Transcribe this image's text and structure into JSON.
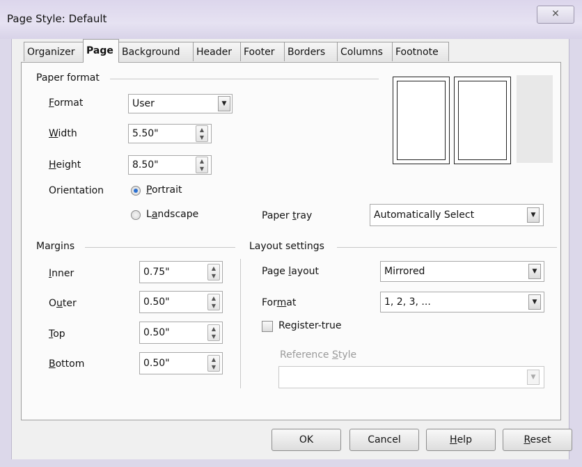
{
  "window": {
    "title": "Page Style: Default",
    "close_glyph": "✕"
  },
  "tabs": [
    {
      "label": "Organizer",
      "active": false
    },
    {
      "label": "Page",
      "active": true
    },
    {
      "label": "Background",
      "active": false
    },
    {
      "label": "Header",
      "active": false
    },
    {
      "label": "Footer",
      "active": false
    },
    {
      "label": "Borders",
      "active": false
    },
    {
      "label": "Columns",
      "active": false
    },
    {
      "label": "Footnote",
      "active": false
    }
  ],
  "paper_format": {
    "heading": "Paper format",
    "format_label": "Format",
    "format_value": "User",
    "width_label": "Width",
    "width_value": "5.50\"",
    "height_label": "Height",
    "height_value": "8.50\"",
    "orientation_label": "Orientation",
    "portrait_label": "Portrait",
    "landscape_label": "Landscape",
    "orientation_selected": "Portrait",
    "paper_tray_label": "Paper tray",
    "paper_tray_value": "Automatically Select"
  },
  "margins": {
    "heading": "Margins",
    "inner_label": "Inner",
    "inner_value": "0.75\"",
    "outer_label": "Outer",
    "outer_value": "0.50\"",
    "top_label": "Top",
    "top_value": "0.50\"",
    "bottom_label": "Bottom",
    "bottom_value": "0.50\""
  },
  "layout_settings": {
    "heading": "Layout settings",
    "page_layout_label": "Page layout",
    "page_layout_value": "Mirrored",
    "format_label": "Format",
    "format_value": "1, 2, 3, ...",
    "register_true_label": "Register-true",
    "register_true_checked": false,
    "reference_style_label": "Reference Style",
    "reference_style_value": ""
  },
  "buttons": {
    "ok": "OK",
    "cancel": "Cancel",
    "help": "Help",
    "reset": "Reset"
  },
  "colors": {
    "accent_radio": "#2a6fd0",
    "dialog_bg": "#f0f0f0",
    "titlebar": "#dcd6ec"
  }
}
